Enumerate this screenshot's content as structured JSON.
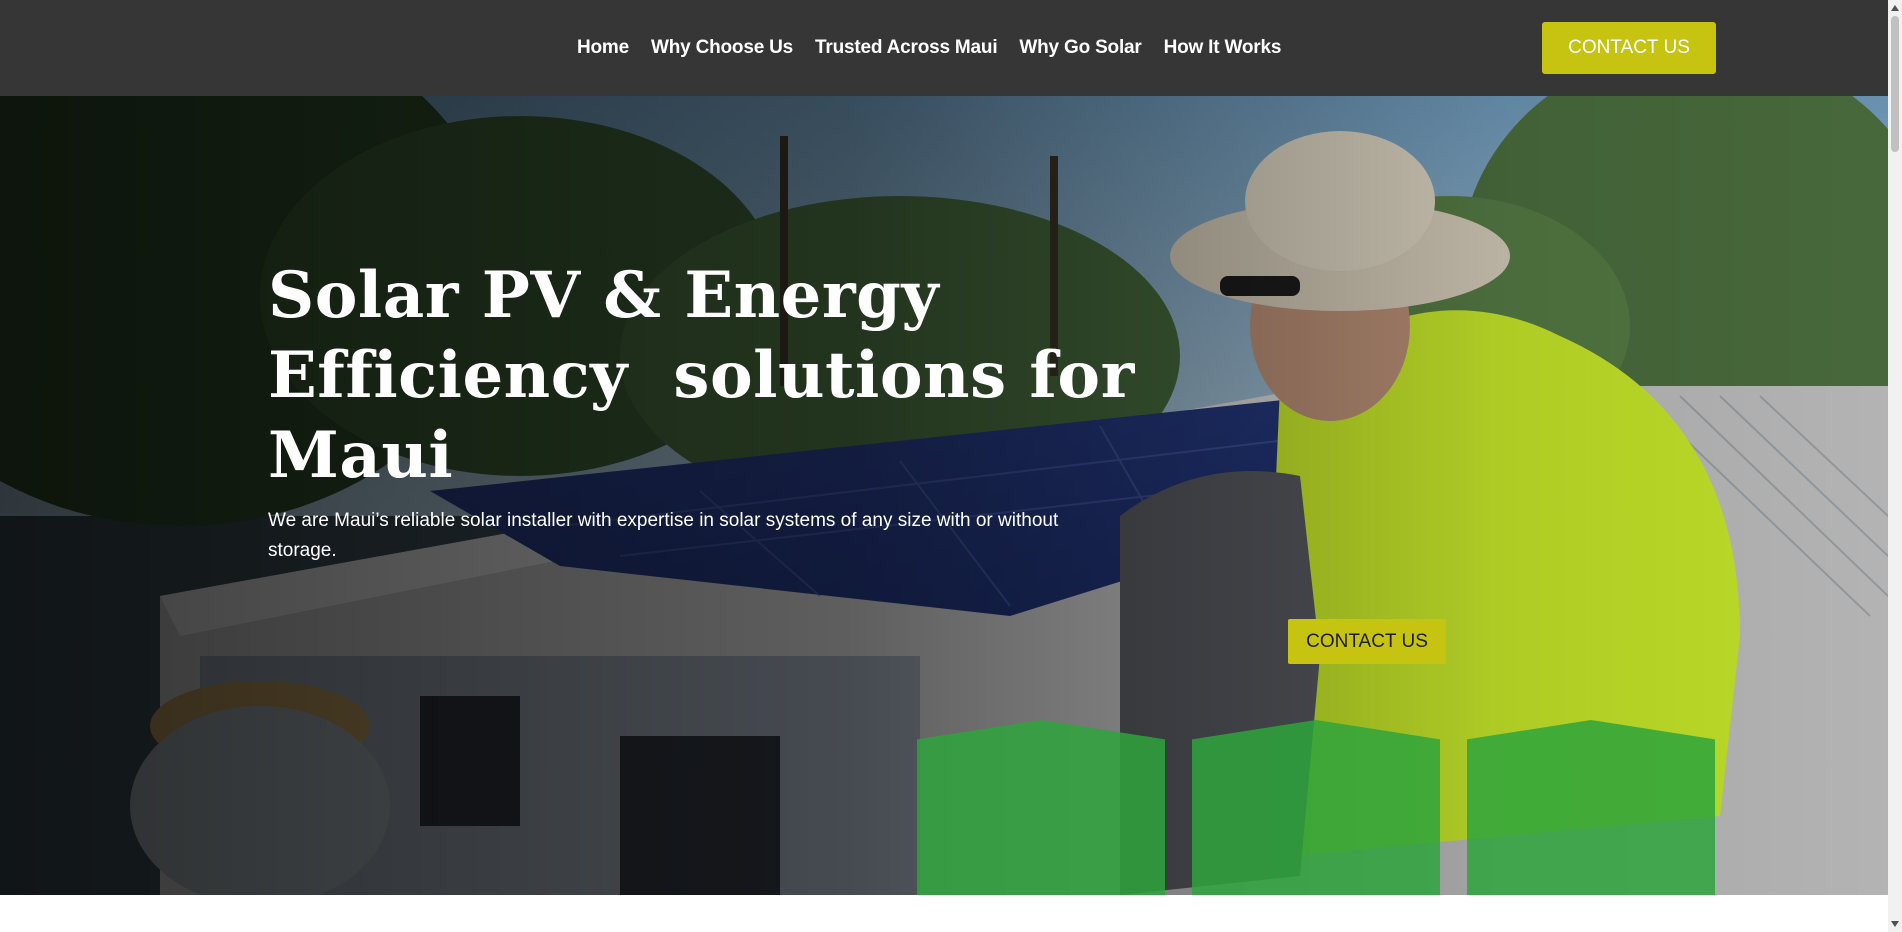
{
  "nav": {
    "links": [
      "Home",
      "Why Choose Us",
      "Trusted Across Maui",
      "Why Go Solar",
      "How It Works"
    ],
    "cta_label": "CONTACT US"
  },
  "hero": {
    "title_line1": "Solar PV & Energy",
    "title_line2": "Efficiency  solutions for",
    "title_line3": "Maui",
    "subtitle": "We are Maui’s reliable solar installer with expertise in solar systems of any size with or without storage.",
    "cta_label": "CONTACT US",
    "background_image": "solar-installer-on-roof-photo"
  },
  "colors": {
    "accent": "#c6c410",
    "nav_bg": "#363636",
    "panel_green": "#2ea53c"
  },
  "icons": {
    "scroll_up": "chevron-up-icon",
    "scroll_down": "chevron-down-icon"
  }
}
